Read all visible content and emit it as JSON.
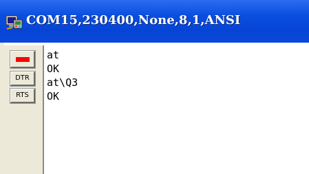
{
  "window": {
    "title": "COM15,230400,None,8,1,ANSI"
  },
  "controls": {
    "dtr_label": "DTR",
    "rts_label": "RTS",
    "indicator_color": "#ff0000"
  },
  "terminal": {
    "lines": [
      "at",
      "OK",
      "at\\Q3",
      "OK"
    ]
  },
  "colors": {
    "titlebar": "#0a4fe0",
    "panel": "#ece9d8"
  },
  "icons": {
    "title_icon": "serial-port-terminal-icon"
  }
}
